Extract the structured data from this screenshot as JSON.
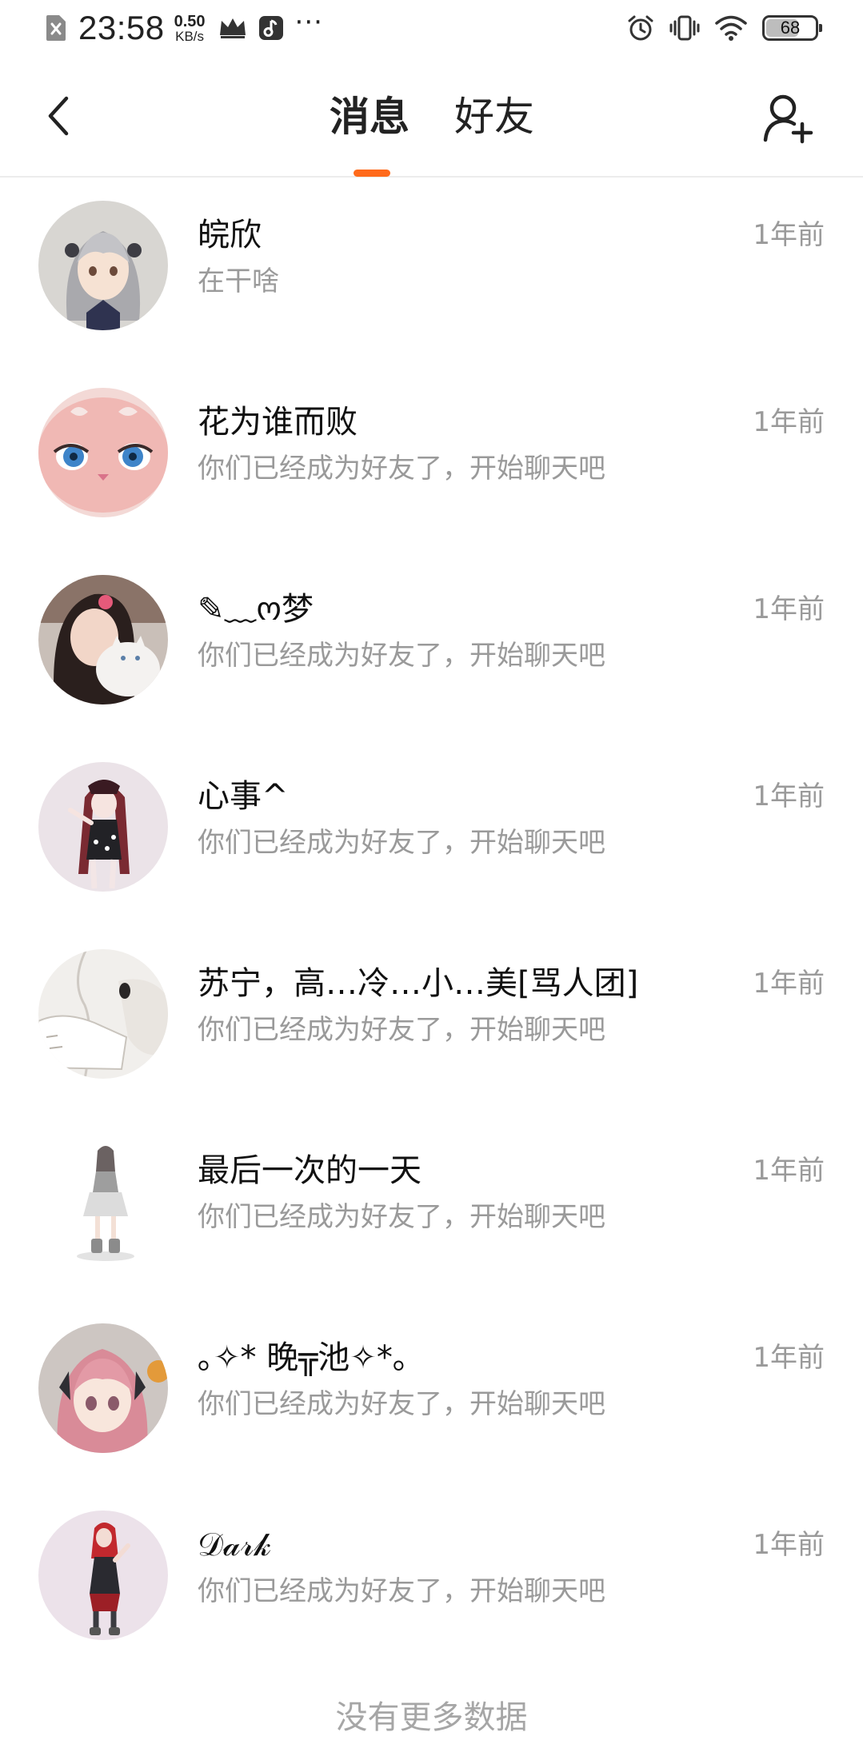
{
  "status_bar": {
    "time": "23:58",
    "net_speed_value": "0.50",
    "net_speed_unit": "KB/s",
    "more": "···",
    "battery_level": "68",
    "left_icons": [
      "no-sim-icon",
      "crown-icon",
      "music-app-icon"
    ],
    "right_icons": [
      "alarm-icon",
      "vibrate-icon",
      "wifi-icon",
      "battery-icon"
    ]
  },
  "header": {
    "tabs": [
      {
        "label": "消息",
        "active": true
      },
      {
        "label": "好友",
        "active": false
      }
    ],
    "accent_color": "#ff6a1a",
    "icons": [
      "back-arrow-icon",
      "add-friend-icon"
    ]
  },
  "conversations": [
    {
      "name": "皖欣",
      "preview": "在干啥",
      "time": "1年前"
    },
    {
      "name": "花为谁而败",
      "preview": "你们已经成为好友了，开始聊天吧",
      "time": "1年前"
    },
    {
      "name": "✎﹏ო梦",
      "preview": "你们已经成为好友了，开始聊天吧",
      "time": "1年前"
    },
    {
      "name": "心事^",
      "preview": "你们已经成为好友了，开始聊天吧",
      "time": "1年前"
    },
    {
      "name": "苏宁，高…冷…小…美[骂人团]",
      "preview": "你们已经成为好友了，开始聊天吧",
      "time": "1年前"
    },
    {
      "name": "最后一次的一天",
      "preview": "你们已经成为好友了，开始聊天吧",
      "time": "1年前"
    },
    {
      "name": "｡✧* 晚╦池✧*｡",
      "preview": "你们已经成为好友了，开始聊天吧",
      "time": "1年前"
    },
    {
      "name": "𝒟𝒶𝓇𝓀",
      "preview": "你们已经成为好友了，开始聊天吧",
      "time": "1年前"
    }
  ],
  "footer": {
    "no_more_text": "没有更多数据"
  }
}
